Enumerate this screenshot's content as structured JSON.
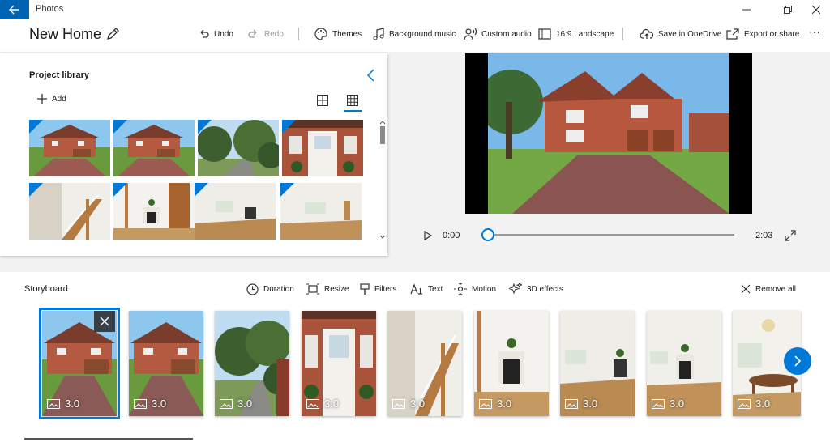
{
  "window": {
    "app_title": "Photos",
    "back_icon": "back-arrow-icon",
    "controls": [
      "minimize-icon",
      "restore-icon",
      "close-icon"
    ]
  },
  "header": {
    "project_title": "New Home",
    "toolbar": {
      "undo": "Undo",
      "redo": "Redo",
      "themes": "Themes",
      "background_music": "Background music",
      "custom_audio": "Custom audio",
      "aspect_ratio": "16:9 Landscape",
      "save_onedrive": "Save in OneDrive",
      "export_share": "Export or share",
      "more": "···"
    }
  },
  "library": {
    "title": "Project library",
    "add_label": "Add",
    "thumbnails": [
      {
        "scene": "house-front"
      },
      {
        "scene": "house-front"
      },
      {
        "scene": "garden-trees"
      },
      {
        "scene": "front-door"
      },
      {
        "scene": "staircase"
      },
      {
        "scene": "fireplace-room"
      },
      {
        "scene": "empty-room"
      },
      {
        "scene": "empty-room"
      }
    ]
  },
  "player": {
    "current_time": "0:00",
    "total_time": "2:03",
    "progress": 0.0
  },
  "storyboard": {
    "title": "Storyboard",
    "tools": {
      "duration": "Duration",
      "resize": "Resize",
      "filters": "Filters",
      "text": "Text",
      "motion": "Motion",
      "effects_3d": "3D effects",
      "remove_all": "Remove all"
    },
    "clips": [
      {
        "scene": "house-front",
        "duration": "3.0",
        "selected": true
      },
      {
        "scene": "house-front",
        "duration": "3.0"
      },
      {
        "scene": "garden-trees",
        "duration": "3.0"
      },
      {
        "scene": "front-door",
        "duration": "3.0"
      },
      {
        "scene": "staircase",
        "duration": "3.0"
      },
      {
        "scene": "fireplace-room",
        "duration": "3.0"
      },
      {
        "scene": "empty-room",
        "duration": "3.0"
      },
      {
        "scene": "fireplace-room-2",
        "duration": "3.0"
      },
      {
        "scene": "dining-room",
        "duration": "3.0"
      }
    ]
  },
  "colors": {
    "accent": "#0078d7",
    "title_bar_accent": "#0063b1"
  }
}
